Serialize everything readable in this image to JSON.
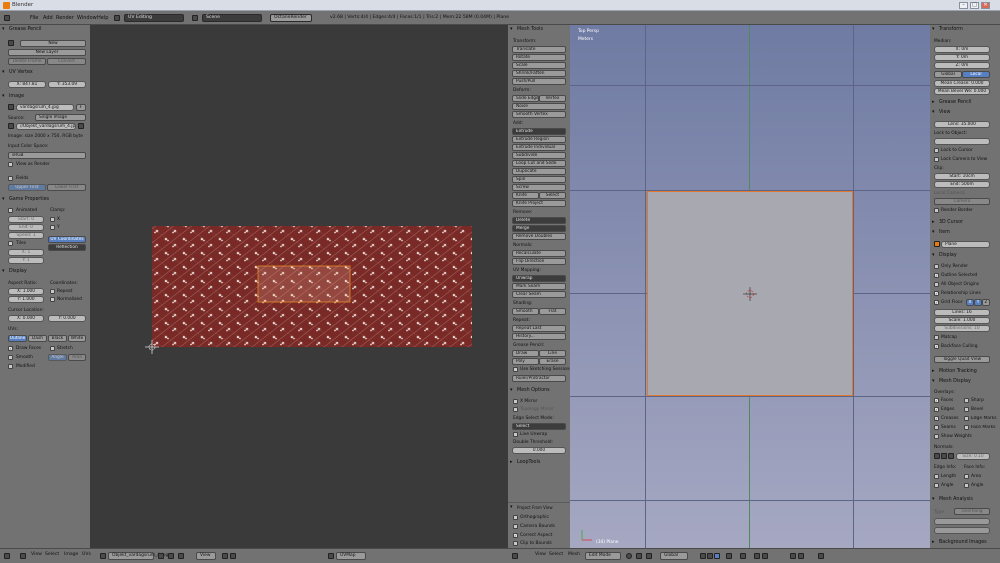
{
  "window": {
    "title": "Blender",
    "min": "–",
    "max": "□",
    "close": "✕"
  },
  "topbar": {
    "menus": [
      "File",
      "Add",
      "Render",
      "Window",
      "Help"
    ],
    "screen": "UV Editing",
    "scene": "Scene",
    "engine": "OctaneRender",
    "stats": "v2.68 | Verts:4/4 | Edges:4/4 | Faces:1/1 | Tris:2 | Mem:22.58M (0.04M) | Plane"
  },
  "left": {
    "grease_pencil": {
      "header": "Grease Pencil",
      "new": "New",
      "new_layer": "New Layer",
      "delete_frame": "Delete Frame",
      "convert": "Convert"
    },
    "uv_vertex": {
      "header": "UV Vertex",
      "x": "X: 847.81",
      "y": "Y: 353.09"
    },
    "image": {
      "header": "Image",
      "name": "vardagsrum_4.jpg",
      "f": "F",
      "source_label": "Source:",
      "source": "Single Image",
      "file": "//Objekt_vardagsrum_4.jpg",
      "info": "Image: size 2000 x 750, RGB byte",
      "color_space_label": "Input Color Space:",
      "color_space": "sRGB",
      "view_as_render": "View as Render",
      "fields": "Fields",
      "upper_first": "Upper First",
      "lower_first": "Lower First"
    },
    "game": {
      "header": "Game Properties",
      "animated": "Animated",
      "clamp": "Clamp:",
      "start": "Start: 0",
      "end": "End: 0",
      "speed": "Speed: 1",
      "cx": "X",
      "cy": "Y",
      "tiles": "Tiles",
      "tx": "X: 1",
      "ty": "Y: 1",
      "uv_coordinates": "UV Coordinates",
      "reflection": "Reflection"
    },
    "display": {
      "header": "Display",
      "aspect_label": "Aspect Ratio:",
      "ax": "X: 1.000",
      "ay": "Y: 1.000",
      "coordinates": "Coordinates:",
      "repeat": "Repeat",
      "normalized": "Normalized",
      "cursor_label": "Cursor Location:",
      "cx": "X: 0.000",
      "cy": "Y: 0.000",
      "uvs": "UVs:",
      "outline": "Outline",
      "dash": "Dash",
      "black": "Black",
      "white": "White",
      "draw_faces": "Draw Faces",
      "stretch": "Stretch",
      "smooth": "Smooth",
      "angle": "Angle",
      "area": "Area",
      "modified": "Modified"
    }
  },
  "uv": {
    "footer": {
      "view": "View",
      "select": "Select",
      "image": "Image",
      "uvs": "UVs",
      "image_name": "Objekt_vardagsrum_4.jpg",
      "view_drop": "View",
      "uvmap": "UVMap"
    },
    "texture_color": "#7a2a26"
  },
  "tools": {
    "header": "Mesh Tools",
    "transform": "Transform:",
    "translate": "Translate",
    "rotate": "Rotate",
    "scale": "Scale",
    "shrink": "Shrink/Fatten",
    "push": "Push/Pull",
    "deform": "Deform:",
    "slide_edge": "Slide Edge",
    "vertex": "Vertex",
    "noise": "Noise",
    "smooth_vertex": "Smooth Vertex",
    "add": "Add:",
    "extrude": "Extrude",
    "extrude_region": "Extrude Region",
    "extrude_individual": "Extrude Individual",
    "subdivide": "Subdivide",
    "loop_cut": "Loop Cut and Slide",
    "duplicate": "Duplicate",
    "spin": "Spin",
    "screw": "Screw",
    "knife": "Knife",
    "select": "Select",
    "knife_project": "Knife Project",
    "remove": "Remove:",
    "delete": "Delete",
    "merge": "Merge",
    "remove_doubles": "Remove Doubles",
    "normals": "Normals:",
    "recalculate": "Recalculate",
    "flip_direction": "Flip Direction",
    "uv_mapping": "UV Mapping:",
    "unwrap": "Unwrap",
    "mark_seam": "Mark Seam",
    "clear_seam": "Clear Seam",
    "shading": "Shading:",
    "smooth": "Smooth",
    "flat": "Flat",
    "repeat": "Repeat:",
    "repeat_last": "Repeat Last",
    "history": "History...",
    "grease": "Grease Pencil:",
    "draw": "Draw",
    "line": "Line",
    "poly": "Poly",
    "erase": "Erase",
    "use_sketching": "Use Sketching Sessions",
    "ruler": "Ruler/Protractor",
    "mesh_options": "Mesh Options",
    "x_mirror": "X Mirror",
    "topology_mirror": "Topology Mirror",
    "edge_select_mode": "Edge Select Mode:",
    "select_drop": "Select",
    "live_unwrap": "Live Unwrap",
    "double_threshold": "Double Threshold:",
    "threshold": "0.000",
    "looptools": "LoopTools",
    "project_from_view": "Project From View",
    "orthographic": "Orthographic",
    "camera_bounds": "Camera Bounds",
    "correct_aspect": "Correct Aspect",
    "clip_to_bounds": "Clip to Bounds"
  },
  "viewport": {
    "view_name": "Top Persp",
    "units": "Meters",
    "object": "(34) Plane",
    "footer": {
      "view": "View",
      "select": "Select",
      "mesh": "Mesh",
      "mode": "Edit Mode",
      "pivot": "Global"
    }
  },
  "props": {
    "transform": {
      "header": "Transform",
      "median": "Median:",
      "x": "X: 0m",
      "y": "Y: 0m",
      "z": "Z: 0m",
      "global": "Global",
      "local": "Local",
      "crease": "Mean Crease: 0.000",
      "bevel": "Mean Bevel We: 0.000"
    },
    "grease_pencil": "Grease Pencil",
    "view": {
      "header": "View",
      "lens": "Lens: 35.000",
      "lock_to_object": "Lock to Object:",
      "lock_to_cursor": "Lock to Cursor",
      "lock_camera": "Lock Camera to View",
      "clip": "Clip:",
      "start": "Start: 10cm",
      "end": "End: 500m",
      "local_camera": "Local Camera:",
      "camera": "Camera",
      "render_border": "Render Border"
    },
    "cursor": "3D Cursor",
    "item": {
      "header": "Item",
      "name": "Plane"
    },
    "display": {
      "header": "Display",
      "only_render": "Only Render",
      "outline_selected": "Outline Selected",
      "all_object_origins": "All Object Origins",
      "relationship_lines": "Relationship Lines",
      "grid_floor": "Grid Floor",
      "gx": "X",
      "gy": "Y",
      "gz": "Z",
      "lines": "Lines: 16",
      "scale": "Scale: 1.000",
      "subdivisions": "Subdivisions: 10",
      "matcap": "Matcap",
      "backface": "Backface Culling",
      "toggle_quad": "Toggle Quad View"
    },
    "motion_tracking": "Motion Tracking",
    "mesh_display": {
      "header": "Mesh Display",
      "overlays": "Overlays:",
      "faces": "Faces",
      "sharp": "Sharp",
      "edges": "Edges",
      "bevel": "Bevel",
      "creases": "Creases",
      "edge_marks": "Edge Marks",
      "seams": "Seams",
      "face_marks": "Face Marks",
      "show_weights": "Show Weights",
      "normals": "Normals:",
      "size": "Size: 0.10",
      "edge_info": "Edge Info:",
      "face_info": "Face Info:",
      "length": "Length",
      "area": "Area",
      "angle": "Angle",
      "angle2": "Angle"
    },
    "mesh_analysis": {
      "header": "Mesh Analysis",
      "type": "Type:",
      "overhang": "Overhang"
    },
    "background": "Background Images"
  }
}
